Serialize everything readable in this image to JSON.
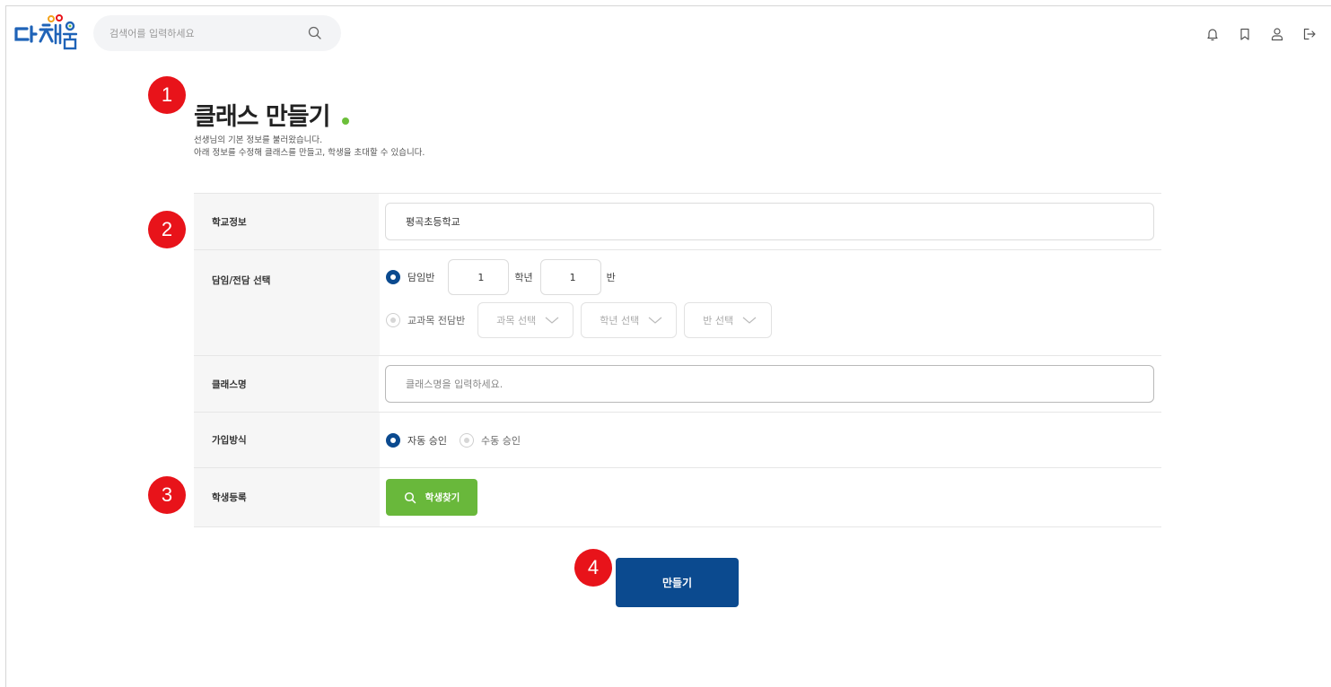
{
  "header": {
    "logo_alt": "다채움",
    "search_placeholder": "검색어를 입력하세요",
    "icons": [
      "bell-icon",
      "bookmark-icon",
      "user-icon",
      "logout-icon"
    ]
  },
  "markers": [
    "1",
    "2",
    "3",
    "4"
  ],
  "page": {
    "title": "클래스 만들기",
    "desc_line1": "선생님의 기본 정보를 불러왔습니다.",
    "desc_line2": "아래 정보를 수정해 클래스를 만들고, 학생을 초대할 수 있습니다."
  },
  "form": {
    "school": {
      "label": "학교정보",
      "value": "평곡초등학교"
    },
    "homeroom": {
      "label": "담임/전담 선택",
      "option_homeroom": "담임반",
      "grade_value": "1",
      "grade_unit": "학년",
      "class_value": "1",
      "class_unit": "반",
      "option_subject": "교과목 전담반",
      "subject_select": "과목 선택",
      "grade_select": "학년 선택",
      "class_select": "반 선택"
    },
    "class_name": {
      "label": "클래스명",
      "placeholder": "클래스명을 입력하세요."
    },
    "join": {
      "label": "가입방식",
      "option_auto": "자동 승인",
      "option_manual": "수동 승인"
    },
    "students": {
      "label": "학생등록",
      "button": "학생찾기"
    }
  },
  "submit_label": "만들기",
  "colors": {
    "primary": "#0b4a8f",
    "green": "#69b83b",
    "marker": "#e8131a"
  }
}
